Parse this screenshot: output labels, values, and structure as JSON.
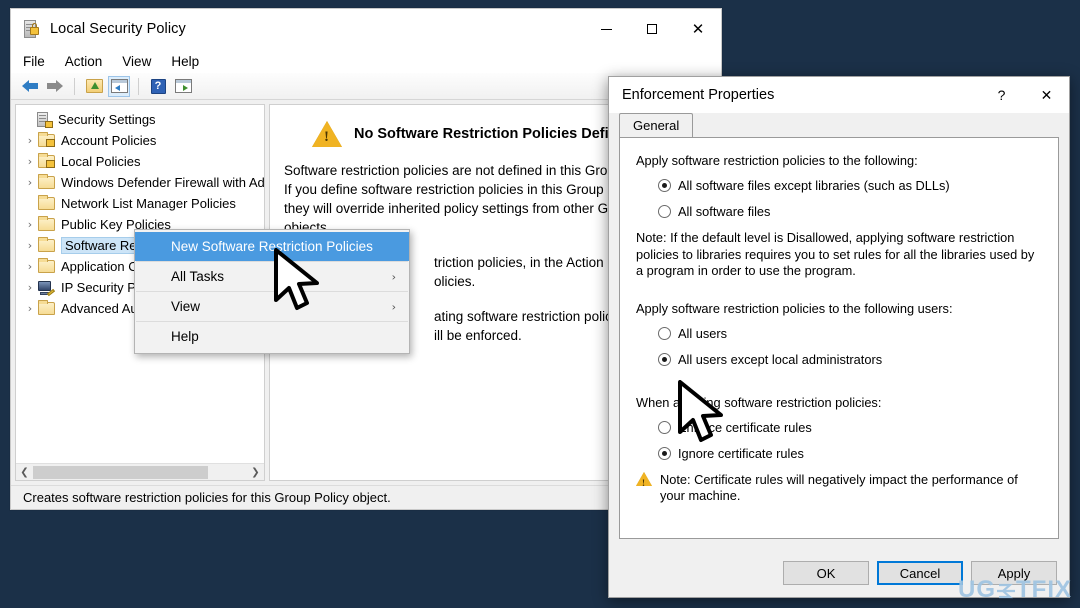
{
  "desktop": {
    "background_color": "#1b3048"
  },
  "mmc": {
    "title": "Local Security Policy",
    "app_icon": "policy-lock-icon",
    "window_controls": {
      "minimize": "–",
      "maximize": "□",
      "close": "✕"
    },
    "menubar": [
      "File",
      "Action",
      "View",
      "Help"
    ],
    "toolbar": [
      {
        "name": "back-icon",
        "glyph": "←"
      },
      {
        "name": "forward-icon",
        "glyph": "→"
      },
      {
        "name": "up-one-level-icon",
        "glyph": "↑"
      },
      {
        "name": "show-hide-console-tree-icon",
        "glyph": "▤"
      },
      {
        "name": "help-icon",
        "glyph": "?"
      },
      {
        "name": "show-hide-action-pane-icon",
        "glyph": "▥"
      }
    ],
    "tree": [
      {
        "label": "Security Settings",
        "icon": "security-settings-icon",
        "expandable": false,
        "indent": 0,
        "selected": false
      },
      {
        "label": "Account Policies",
        "icon": "folder-locked-icon",
        "expandable": true,
        "indent": 1,
        "selected": false
      },
      {
        "label": "Local Policies",
        "icon": "folder-locked-icon",
        "expandable": true,
        "indent": 1,
        "selected": false
      },
      {
        "label": "Windows Defender Firewall with Adva",
        "icon": "folder-icon",
        "expandable": true,
        "indent": 1,
        "selected": false
      },
      {
        "label": "Network List Manager Policies",
        "icon": "folder-icon",
        "expandable": false,
        "indent": 1,
        "selected": false
      },
      {
        "label": "Public Key Policies",
        "icon": "folder-icon",
        "expandable": true,
        "indent": 1,
        "selected": false
      },
      {
        "label": "Software Restriction Policies",
        "icon": "folder-icon",
        "expandable": true,
        "indent": 1,
        "selected": true
      },
      {
        "label": "Application C",
        "icon": "folder-icon",
        "expandable": true,
        "indent": 1,
        "selected": false
      },
      {
        "label": "IP Security Po",
        "icon": "ip-security-icon",
        "expandable": true,
        "indent": 1,
        "selected": false
      },
      {
        "label": "Advanced Au",
        "icon": "folder-icon",
        "expandable": true,
        "indent": 1,
        "selected": false
      }
    ],
    "detail": {
      "heading": "No Software Restriction Policies Defined",
      "warning_icon": "warning-triangle-icon",
      "paragraph1": "Software restriction policies are not defined in this Group P\nIf you define software restriction policies in this Group Poli\nthey will override inherited policy settings from other Grou\nobjects.",
      "paragraph2": "triction policies, in the Action menu,\nolicies.",
      "paragraph3": "ating software restriction policies, a\nill be enforced."
    },
    "status_text": "Creates software restriction policies for this Group Policy object."
  },
  "context_menu": {
    "items": [
      {
        "label": "New Software Restriction Policies",
        "highlighted": true,
        "submenu": false
      },
      {
        "label": "All Tasks",
        "highlighted": false,
        "submenu": true
      },
      {
        "label": "View",
        "highlighted": false,
        "submenu": true
      },
      {
        "label": "Help",
        "highlighted": false,
        "submenu": false
      }
    ],
    "submenu_glyph": "›",
    "highlight_color": "#4a9ae0"
  },
  "dialog": {
    "title": "Enforcement Properties",
    "help_glyph": "?",
    "close_glyph": "✕",
    "tabs": [
      {
        "label": "General",
        "active": true
      }
    ],
    "section1_label": "Apply software restriction policies to the following:",
    "section1_options": [
      {
        "label": "All software files except libraries (such as DLLs)",
        "checked": true
      },
      {
        "label": "All software files",
        "checked": false
      }
    ],
    "section1_note": "Note:  If the default level is Disallowed, applying software restriction policies to libraries requires you to set rules for all the libraries used by a program in order to use the program.",
    "section2_label": "Apply software restriction policies to the following users:",
    "section2_options": [
      {
        "label": "All users",
        "checked": false
      },
      {
        "label": "All users except local administrators",
        "checked": true
      }
    ],
    "section3_label": "When applying software restriction policies:",
    "section3_options": [
      {
        "label": "Enforce certificate rules",
        "checked": false
      },
      {
        "label": "Ignore certificate rules",
        "checked": true
      }
    ],
    "bottom_note": "Note:  Certificate rules will negatively impact the performance of your machine.",
    "bottom_note_icon": "warning-triangle-icon",
    "buttons": [
      {
        "label": "OK",
        "default": false
      },
      {
        "label": "Cancel",
        "default": true
      },
      {
        "label": "Apply",
        "default": false
      }
    ]
  },
  "watermark": {
    "part1": "UG",
    "part2": "TFIX",
    "color": "#9fc4e2"
  }
}
